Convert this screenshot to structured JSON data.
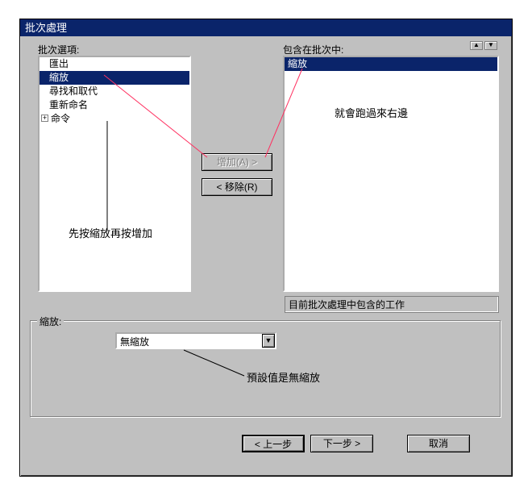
{
  "window": {
    "title": "批次處理"
  },
  "left_label": "批次選項:",
  "right_label": "包含在批次中:",
  "left_list": {
    "items": [
      "匯出",
      "縮放",
      "尋找和取代",
      "重新命名",
      "命令"
    ],
    "selected_index": 1,
    "tree_parent_index": 4
  },
  "right_list": {
    "items": [
      "縮放"
    ],
    "selected_index": 0
  },
  "buttons": {
    "add": "增加(A) >",
    "remove": "< 移除(R)",
    "back": "< 上一步",
    "next": "下一步 >",
    "cancel": "取消"
  },
  "annotations": {
    "a1": "先按縮放再按增加",
    "a2": "就會跑過來右邊",
    "a3": "預設值是無縮放"
  },
  "group": {
    "title": "縮放:"
  },
  "combo": {
    "value": "無縮放"
  },
  "status": "目前批次處理中包含的工作",
  "colors": {
    "titlebar": "#0a246a",
    "face": "#c0c0c0",
    "arrow": "#ff3060"
  }
}
